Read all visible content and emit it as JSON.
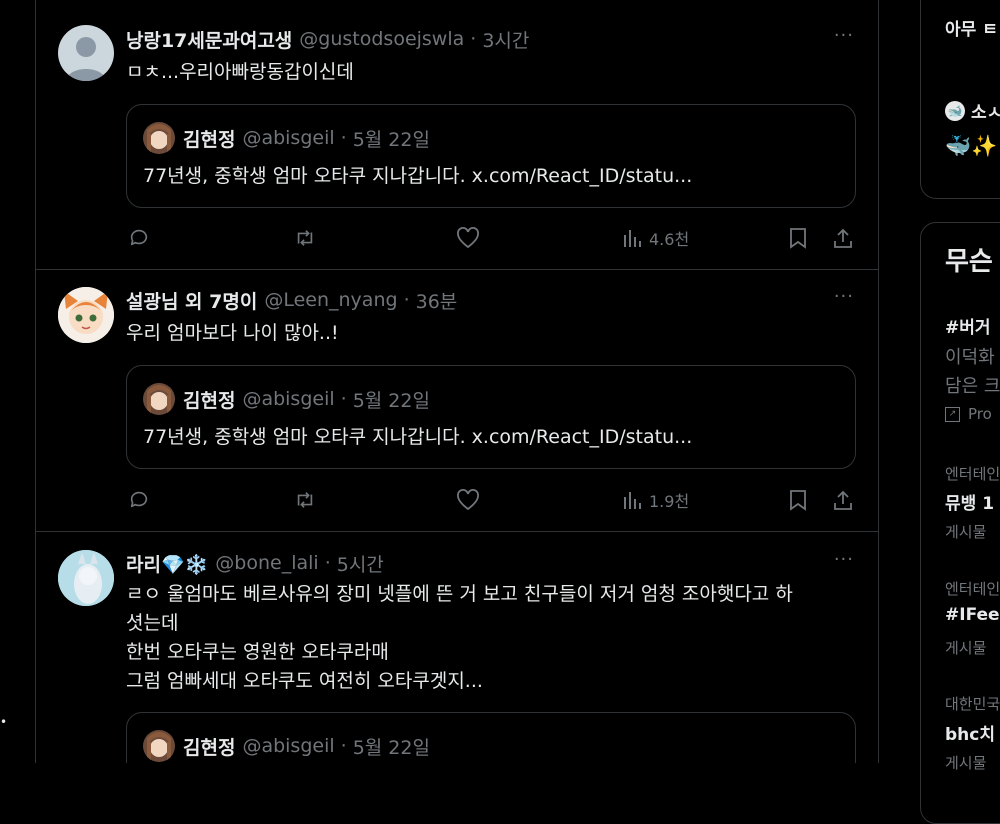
{
  "tweets": [
    {
      "name": "낭랑17세문과여고생",
      "handle": "@gustodsoejswla",
      "time": "3시간",
      "text": "ㅁㅊ...우리아빠랑동갑이신데",
      "quote": {
        "name": "김현정",
        "handle": "@abisgeil",
        "time": "5월 22일",
        "text": "77년생, 중학생 엄마 오타쿠 지나갑니다. x.com/React_ID/statu..."
      },
      "views": "4.6천"
    },
    {
      "name": "설광님 외 7명이",
      "handle": "@Leen_nyang",
      "time": "36분",
      "text": "우리 엄마보다 나이 많아..!",
      "quote": {
        "name": "김현정",
        "handle": "@abisgeil",
        "time": "5월 22일",
        "text": "77년생, 중학생 엄마 오타쿠 지나갑니다. x.com/React_ID/statu..."
      },
      "views": "1.9천"
    },
    {
      "name": "라리💎❄️",
      "handle": "@bone_lali",
      "time": "5시간",
      "text": "ㄹㅇ 울엄마도 베르사유의 장미 넷플에 뜬 거 보고 친구들이 저거 엄청 조아햇다고 하\n셧는데\n한번 오타쿠는 영원한 오타쿠라매\n그럼 엄빠세대 오타쿠도 여전히 오타쿠겟지...",
      "quote": {
        "name": "김현정",
        "handle": "@abisgeil",
        "time": "5월 22일"
      }
    }
  ],
  "sidebar": {
    "top_fragment": "아무 ㅌ",
    "space_fragment": "소ㅅ",
    "emoji_row": "🐳✨",
    "trends_title": "무슨",
    "trend1_tag": "#버거",
    "trend1_line1": "이덕화",
    "trend1_line2": "담은 크",
    "trend1_promo": "Pro",
    "trend2_cat": "엔터테인",
    "trend2_title": "뮤뱅 1",
    "trend2_posts": "게시물",
    "trend3_cat": "엔터테인",
    "trend3_title": "#IFee",
    "trend3_posts": "게시물",
    "trend4_cat": "대한민국",
    "trend4_title": "bhc치",
    "trend4_posts": "게시물"
  },
  "more_glyph": "···",
  "left_dot": "•",
  "colors": {
    "bg": "#000000",
    "border": "#2f3336",
    "muted": "#71767b",
    "text": "#e7e9ea"
  }
}
